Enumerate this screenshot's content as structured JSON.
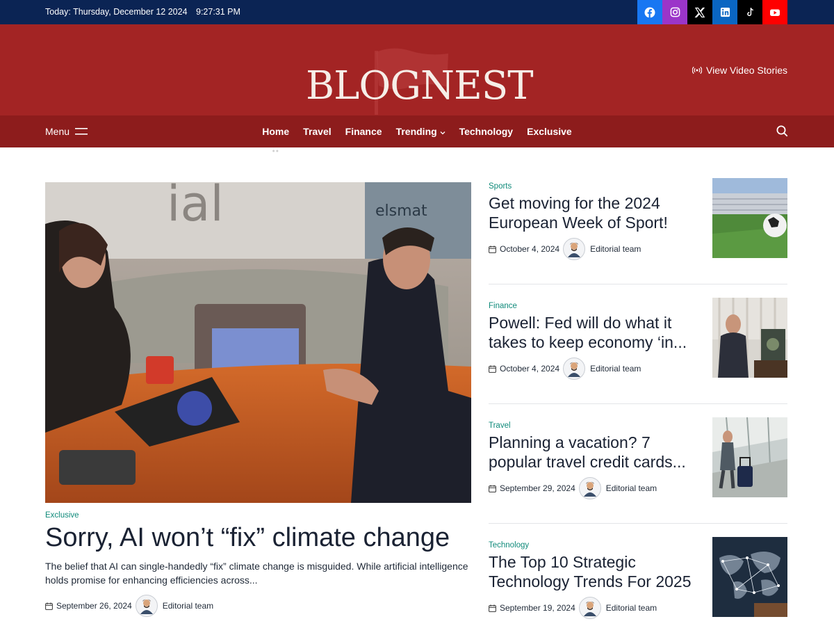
{
  "topbar": {
    "date": "Today: Thursday, December 12 2024",
    "time": "9:27:31 PM",
    "social": [
      {
        "name": "facebook-icon",
        "color": "#1877f2"
      },
      {
        "name": "instagram-icon",
        "color": "#9b35c9"
      },
      {
        "name": "x-icon",
        "color": "#000000"
      },
      {
        "name": "linkedin-icon",
        "color": "#0a66c2"
      },
      {
        "name": "tiktok-icon",
        "color": "#000000"
      },
      {
        "name": "youtube-icon",
        "color": "#ff0000"
      }
    ]
  },
  "header": {
    "logo": "BLOGNEST",
    "video_stories": "View Video Stories",
    "bg_color": "#a32424"
  },
  "nav": {
    "menu_label": "Menu",
    "items": [
      {
        "label": "Home"
      },
      {
        "label": "Travel"
      },
      {
        "label": "Finance"
      },
      {
        "label": "Trending"
      },
      {
        "label": "Technology"
      },
      {
        "label": "Exclusive"
      }
    ]
  },
  "featured": {
    "category": "Exclusive",
    "title": "Sorry, AI won’t “fix” climate change",
    "excerpt": "The belief that AI can single-handedly “fix” climate change is misguided. While artificial intelligence holds promise for enhancing efficiencies across...",
    "date": "September 26, 2024",
    "author": "Editorial team"
  },
  "side_posts": [
    {
      "category": "Sports",
      "title": "Get moving for the 2024 European Week of Sport!",
      "date": "October 4, 2024",
      "author": "Editorial team"
    },
    {
      "category": "Finance",
      "title": "Powell: Fed will do what it takes to keep economy ‘in...",
      "date": "October 4, 2024",
      "author": "Editorial team"
    },
    {
      "category": "Travel",
      "title": "Planning a vacation? 7 popular travel credit cards...",
      "date": "September 29, 2024",
      "author": "Editorial team"
    },
    {
      "category": "Technology",
      "title": "The Top 10 Strategic Technology Trends For 2025",
      "date": "September 19, 2024",
      "author": "Editorial team"
    }
  ],
  "colors": {
    "accent": "#0f8a7a",
    "topbar": "#0b2454",
    "nav": "#8d1c1c"
  }
}
